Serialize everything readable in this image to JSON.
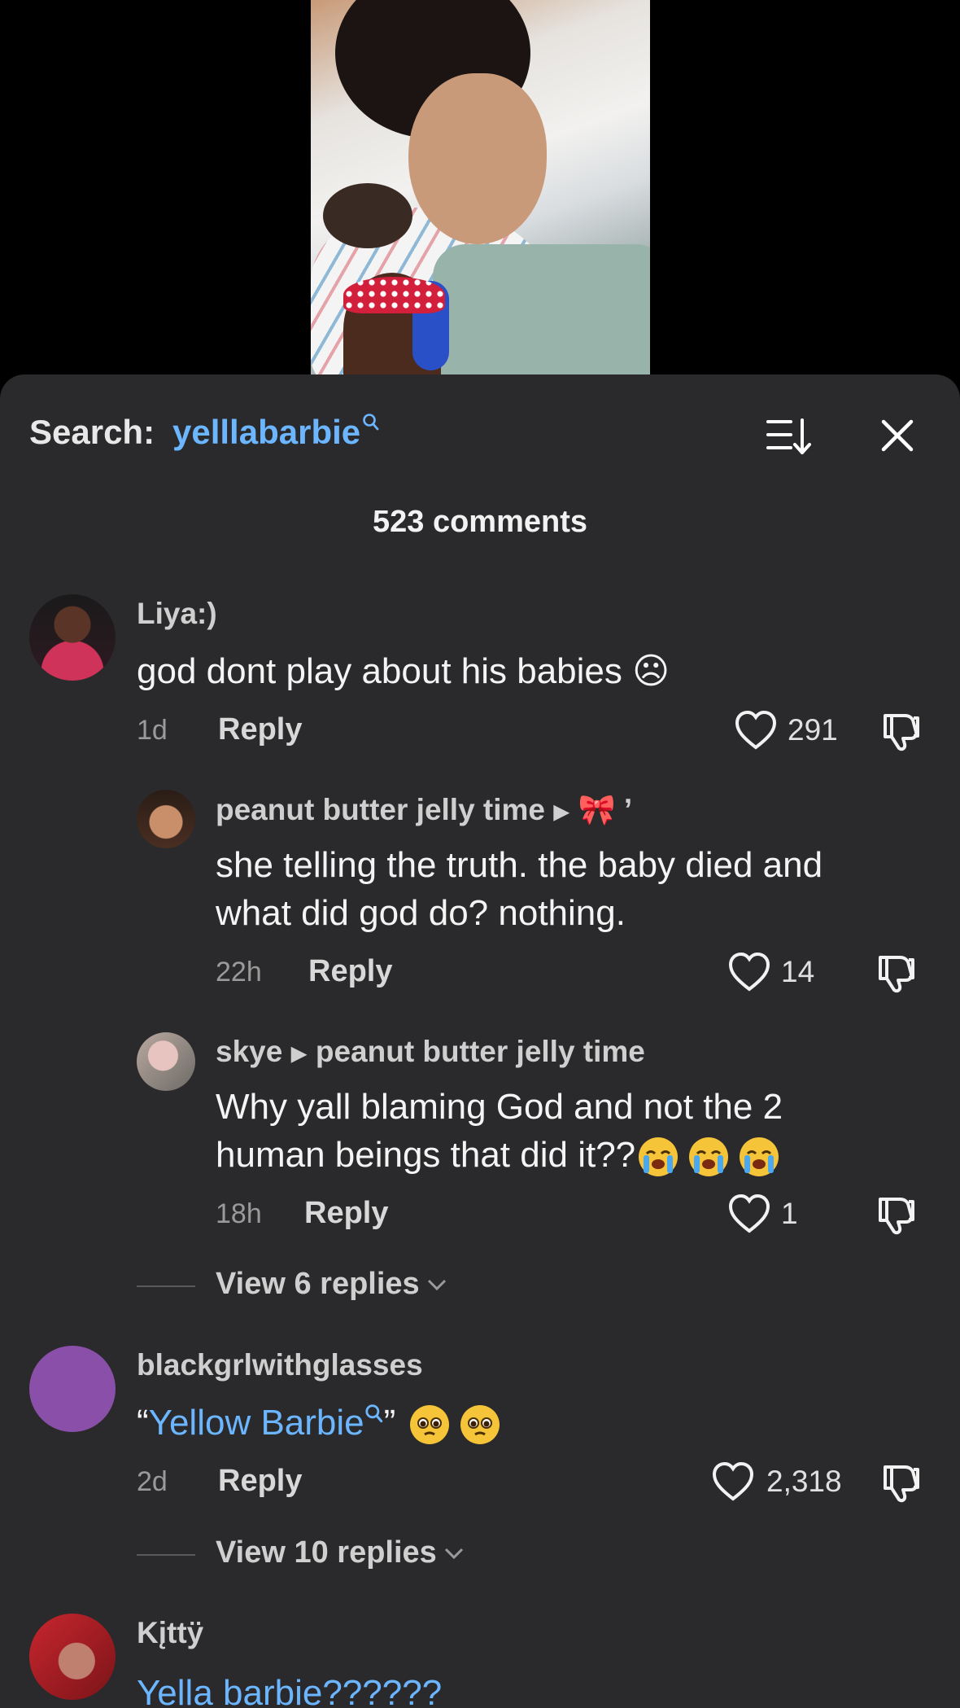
{
  "search": {
    "prefix": "Search:",
    "term": "yelllabarbie"
  },
  "comments_count": "523 comments",
  "comments": [
    {
      "user": "Liya:)",
      "text": "god dont play about his babies ☹",
      "time": "1d",
      "reply": "Reply",
      "likes": "291"
    },
    {
      "user": "peanut butter jelly time",
      "reply_to": "🎀 ’",
      "text1": "she telling the truth. the baby died and",
      "text2": "what did god do? nothing.",
      "time": "22h",
      "reply": "Reply",
      "likes": "14"
    },
    {
      "user": "skye",
      "reply_to": "peanut butter jelly time",
      "text1": "Why yall blaming God and not the 2",
      "text2": "human beings that did it??",
      "time": "18h",
      "reply": "Reply",
      "likes": "1"
    },
    {
      "view_replies": "View 6 replies"
    },
    {
      "user": "blackgrlwithglasses",
      "text_open": "“",
      "text_link": "Yellow Barbie",
      "text_close": "”",
      "time": "2d",
      "reply": "Reply",
      "likes": "2,318"
    },
    {
      "view_replies": "View 10 replies"
    },
    {
      "user": "Kįttÿ",
      "text_partial": "Yella barbie??????"
    }
  ],
  "colors": {
    "accent_blue": "#6cb6ff",
    "sheet_bg": "#2a2a2c",
    "avatar_purple": "#8a4fa8"
  }
}
